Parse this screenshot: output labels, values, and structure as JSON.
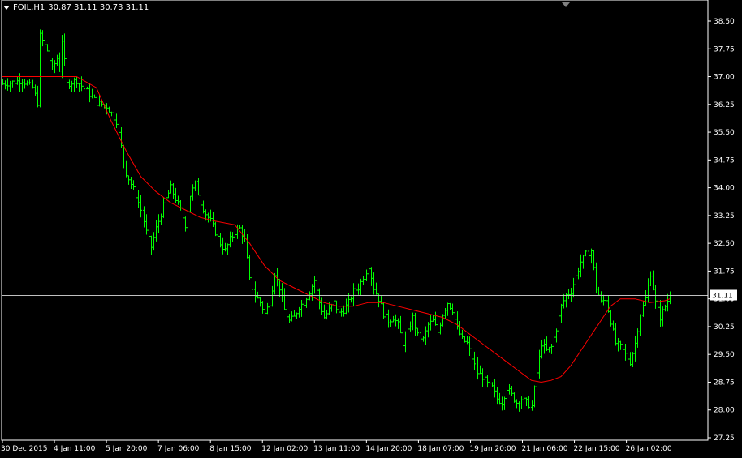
{
  "header": {
    "symbol_timeframe": "FOIL,H1",
    "ohlc": "30.87 31.11 30.73 31.11"
  },
  "colors": {
    "background": "#000000",
    "bars": "#00ff00",
    "moving_average": "#ff0000",
    "bid_line": "#c0c0c0",
    "axis_text": "#ffffff",
    "price_label_bg": "#ffffff",
    "price_label_text": "#000000"
  },
  "chart_data": {
    "type": "ohlc",
    "title": "",
    "xlabel": "",
    "ylabel": "",
    "grid": false,
    "ylim": [
      27.1,
      38.8
    ],
    "y_ticks": [
      "38.50",
      "37.75",
      "37.00",
      "36.25",
      "35.50",
      "34.75",
      "34.00",
      "33.25",
      "32.50",
      "31.75",
      "31.00",
      "30.25",
      "29.50",
      "28.75",
      "28.00",
      "27.25"
    ],
    "x_ticks": [
      "30 Dec 2015",
      "4 Jan 11:00",
      "5 Jan 20:00",
      "7 Jan 06:00",
      "8 Jan 15:00",
      "12 Jan 02:00",
      "13 Jan 11:00",
      "14 Jan 20:00",
      "18 Jan 07:00",
      "19 Jan 20:00",
      "21 Jan 06:00",
      "22 Jan 15:00",
      "26 Jan 02:00"
    ],
    "current_price": "31.11",
    "close_path": [
      [
        0,
        36.8
      ],
      [
        8,
        36.9
      ],
      [
        12,
        36.7
      ],
      [
        14,
        36.3
      ],
      [
        15,
        38.1
      ],
      [
        18,
        37.7
      ],
      [
        20,
        37.2
      ],
      [
        22,
        37.5
      ],
      [
        23,
        37.2
      ],
      [
        24,
        38.0
      ],
      [
        26,
        36.8
      ],
      [
        30,
        36.9
      ],
      [
        34,
        36.6
      ],
      [
        38,
        36.3
      ],
      [
        42,
        36.2
      ],
      [
        46,
        35.8
      ],
      [
        48,
        35.1
      ],
      [
        50,
        34.4
      ],
      [
        52,
        34.1
      ],
      [
        54,
        33.8
      ],
      [
        56,
        33.4
      ],
      [
        58,
        32.8
      ],
      [
        60,
        32.4
      ],
      [
        62,
        32.9
      ],
      [
        64,
        33.3
      ],
      [
        66,
        33.7
      ],
      [
        68,
        34.0
      ],
      [
        70,
        33.7
      ],
      [
        72,
        33.4
      ],
      [
        74,
        33.0
      ],
      [
        76,
        33.8
      ],
      [
        78,
        34.1
      ],
      [
        80,
        33.6
      ],
      [
        82,
        33.3
      ],
      [
        84,
        33.1
      ],
      [
        86,
        32.8
      ],
      [
        88,
        32.5
      ],
      [
        90,
        32.3
      ],
      [
        92,
        32.6
      ],
      [
        94,
        32.8
      ],
      [
        96,
        32.9
      ],
      [
        98,
        32.6
      ],
      [
        100,
        31.5
      ],
      [
        102,
        31.1
      ],
      [
        104,
        30.9
      ],
      [
        106,
        30.6
      ],
      [
        108,
        30.9
      ],
      [
        110,
        31.7
      ],
      [
        112,
        31.3
      ],
      [
        114,
        30.7
      ],
      [
        116,
        30.4
      ],
      [
        118,
        30.5
      ],
      [
        120,
        30.8
      ],
      [
        122,
        30.9
      ],
      [
        124,
        31.2
      ],
      [
        126,
        31.5
      ],
      [
        128,
        30.9
      ],
      [
        130,
        30.5
      ],
      [
        132,
        30.7
      ],
      [
        134,
        30.9
      ],
      [
        136,
        30.6
      ],
      [
        138,
        30.7
      ],
      [
        140,
        30.9
      ],
      [
        142,
        31.2
      ],
      [
        144,
        31.3
      ],
      [
        146,
        31.6
      ],
      [
        148,
        31.9
      ],
      [
        150,
        31.3
      ],
      [
        152,
        31.0
      ],
      [
        154,
        30.6
      ],
      [
        156,
        30.4
      ],
      [
        158,
        30.5
      ],
      [
        160,
        30.3
      ],
      [
        162,
        29.8
      ],
      [
        164,
        30.1
      ],
      [
        166,
        30.5
      ],
      [
        168,
        30.0
      ],
      [
        170,
        29.9
      ],
      [
        172,
        30.3
      ],
      [
        174,
        30.4
      ],
      [
        176,
        30.1
      ],
      [
        178,
        30.6
      ],
      [
        180,
        30.9
      ],
      [
        182,
        30.7
      ],
      [
        184,
        30.2
      ],
      [
        186,
        29.9
      ],
      [
        188,
        29.8
      ],
      [
        190,
        29.4
      ],
      [
        192,
        29.0
      ],
      [
        194,
        28.9
      ],
      [
        196,
        28.7
      ],
      [
        198,
        28.6
      ],
      [
        200,
        28.3
      ],
      [
        202,
        28.2
      ],
      [
        204,
        28.6
      ],
      [
        206,
        28.4
      ],
      [
        208,
        28.2
      ],
      [
        210,
        28.3
      ],
      [
        212,
        28.2
      ],
      [
        214,
        28.1
      ],
      [
        216,
        29.0
      ],
      [
        218,
        29.8
      ],
      [
        220,
        29.6
      ],
      [
        222,
        29.7
      ],
      [
        224,
        30.2
      ],
      [
        226,
        30.8
      ],
      [
        228,
        31.1
      ],
      [
        230,
        31.2
      ],
      [
        232,
        31.6
      ],
      [
        234,
        32.0
      ],
      [
        236,
        32.2
      ],
      [
        238,
        32.3
      ],
      [
        240,
        31.3
      ],
      [
        242,
        30.9
      ],
      [
        244,
        31.0
      ],
      [
        246,
        30.4
      ],
      [
        248,
        29.8
      ],
      [
        250,
        29.7
      ],
      [
        252,
        29.5
      ],
      [
        254,
        29.3
      ],
      [
        256,
        29.8
      ],
      [
        258,
        30.6
      ],
      [
        260,
        31.0
      ],
      [
        262,
        31.7
      ],
      [
        264,
        30.9
      ],
      [
        266,
        30.5
      ],
      [
        268,
        30.8
      ],
      [
        270,
        31.1
      ]
    ],
    "ma_path": [
      [
        0,
        37.0
      ],
      [
        30,
        37.0
      ],
      [
        38,
        36.7
      ],
      [
        44,
        35.8
      ],
      [
        50,
        35.0
      ],
      [
        56,
        34.3
      ],
      [
        62,
        33.9
      ],
      [
        68,
        33.6
      ],
      [
        74,
        33.4
      ],
      [
        80,
        33.2
      ],
      [
        86,
        33.1
      ],
      [
        94,
        33.0
      ],
      [
        100,
        32.5
      ],
      [
        106,
        31.9
      ],
      [
        112,
        31.5
      ],
      [
        118,
        31.3
      ],
      [
        124,
        31.1
      ],
      [
        130,
        30.9
      ],
      [
        136,
        30.8
      ],
      [
        142,
        30.8
      ],
      [
        148,
        30.9
      ],
      [
        154,
        30.9
      ],
      [
        160,
        30.8
      ],
      [
        166,
        30.7
      ],
      [
        172,
        30.6
      ],
      [
        178,
        30.5
      ],
      [
        184,
        30.3
      ],
      [
        190,
        30.0
      ],
      [
        196,
        29.7
      ],
      [
        202,
        29.4
      ],
      [
        208,
        29.1
      ],
      [
        214,
        28.8
      ],
      [
        218,
        28.75
      ],
      [
        222,
        28.8
      ],
      [
        226,
        28.9
      ],
      [
        230,
        29.2
      ],
      [
        234,
        29.6
      ],
      [
        238,
        30.0
      ],
      [
        242,
        30.4
      ],
      [
        246,
        30.8
      ],
      [
        250,
        31.0
      ],
      [
        256,
        31.0
      ],
      [
        262,
        30.9
      ],
      [
        268,
        30.95
      ],
      [
        270,
        31.0
      ]
    ]
  }
}
